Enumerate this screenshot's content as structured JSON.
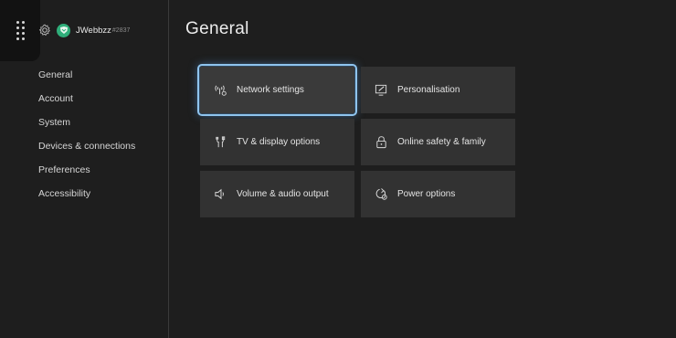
{
  "profile": {
    "gamertag": "JWebbzz",
    "gamertag_suffix": "#2837"
  },
  "nav": {
    "items": [
      {
        "label": "General"
      },
      {
        "label": "Account"
      },
      {
        "label": "System"
      },
      {
        "label": "Devices & connections"
      },
      {
        "label": "Preferences"
      },
      {
        "label": "Accessibility"
      }
    ]
  },
  "page": {
    "title": "General"
  },
  "tiles": [
    {
      "label": "Network settings",
      "icon": "network-icon",
      "selected": true
    },
    {
      "label": "Personalisation",
      "icon": "personalisation-icon",
      "selected": false
    },
    {
      "label": "TV & display options",
      "icon": "tv-display-icon",
      "selected": false
    },
    {
      "label": "Online safety & family",
      "icon": "lock-icon",
      "selected": false
    },
    {
      "label": "Volume & audio output",
      "icon": "speaker-icon",
      "selected": false
    },
    {
      "label": "Power options",
      "icon": "power-icon",
      "selected": false
    }
  ],
  "colors": {
    "background": "#1e1e1e",
    "tile": "#323232",
    "focus_outline": "#8fc4ee",
    "avatar": "#2fae7a"
  }
}
